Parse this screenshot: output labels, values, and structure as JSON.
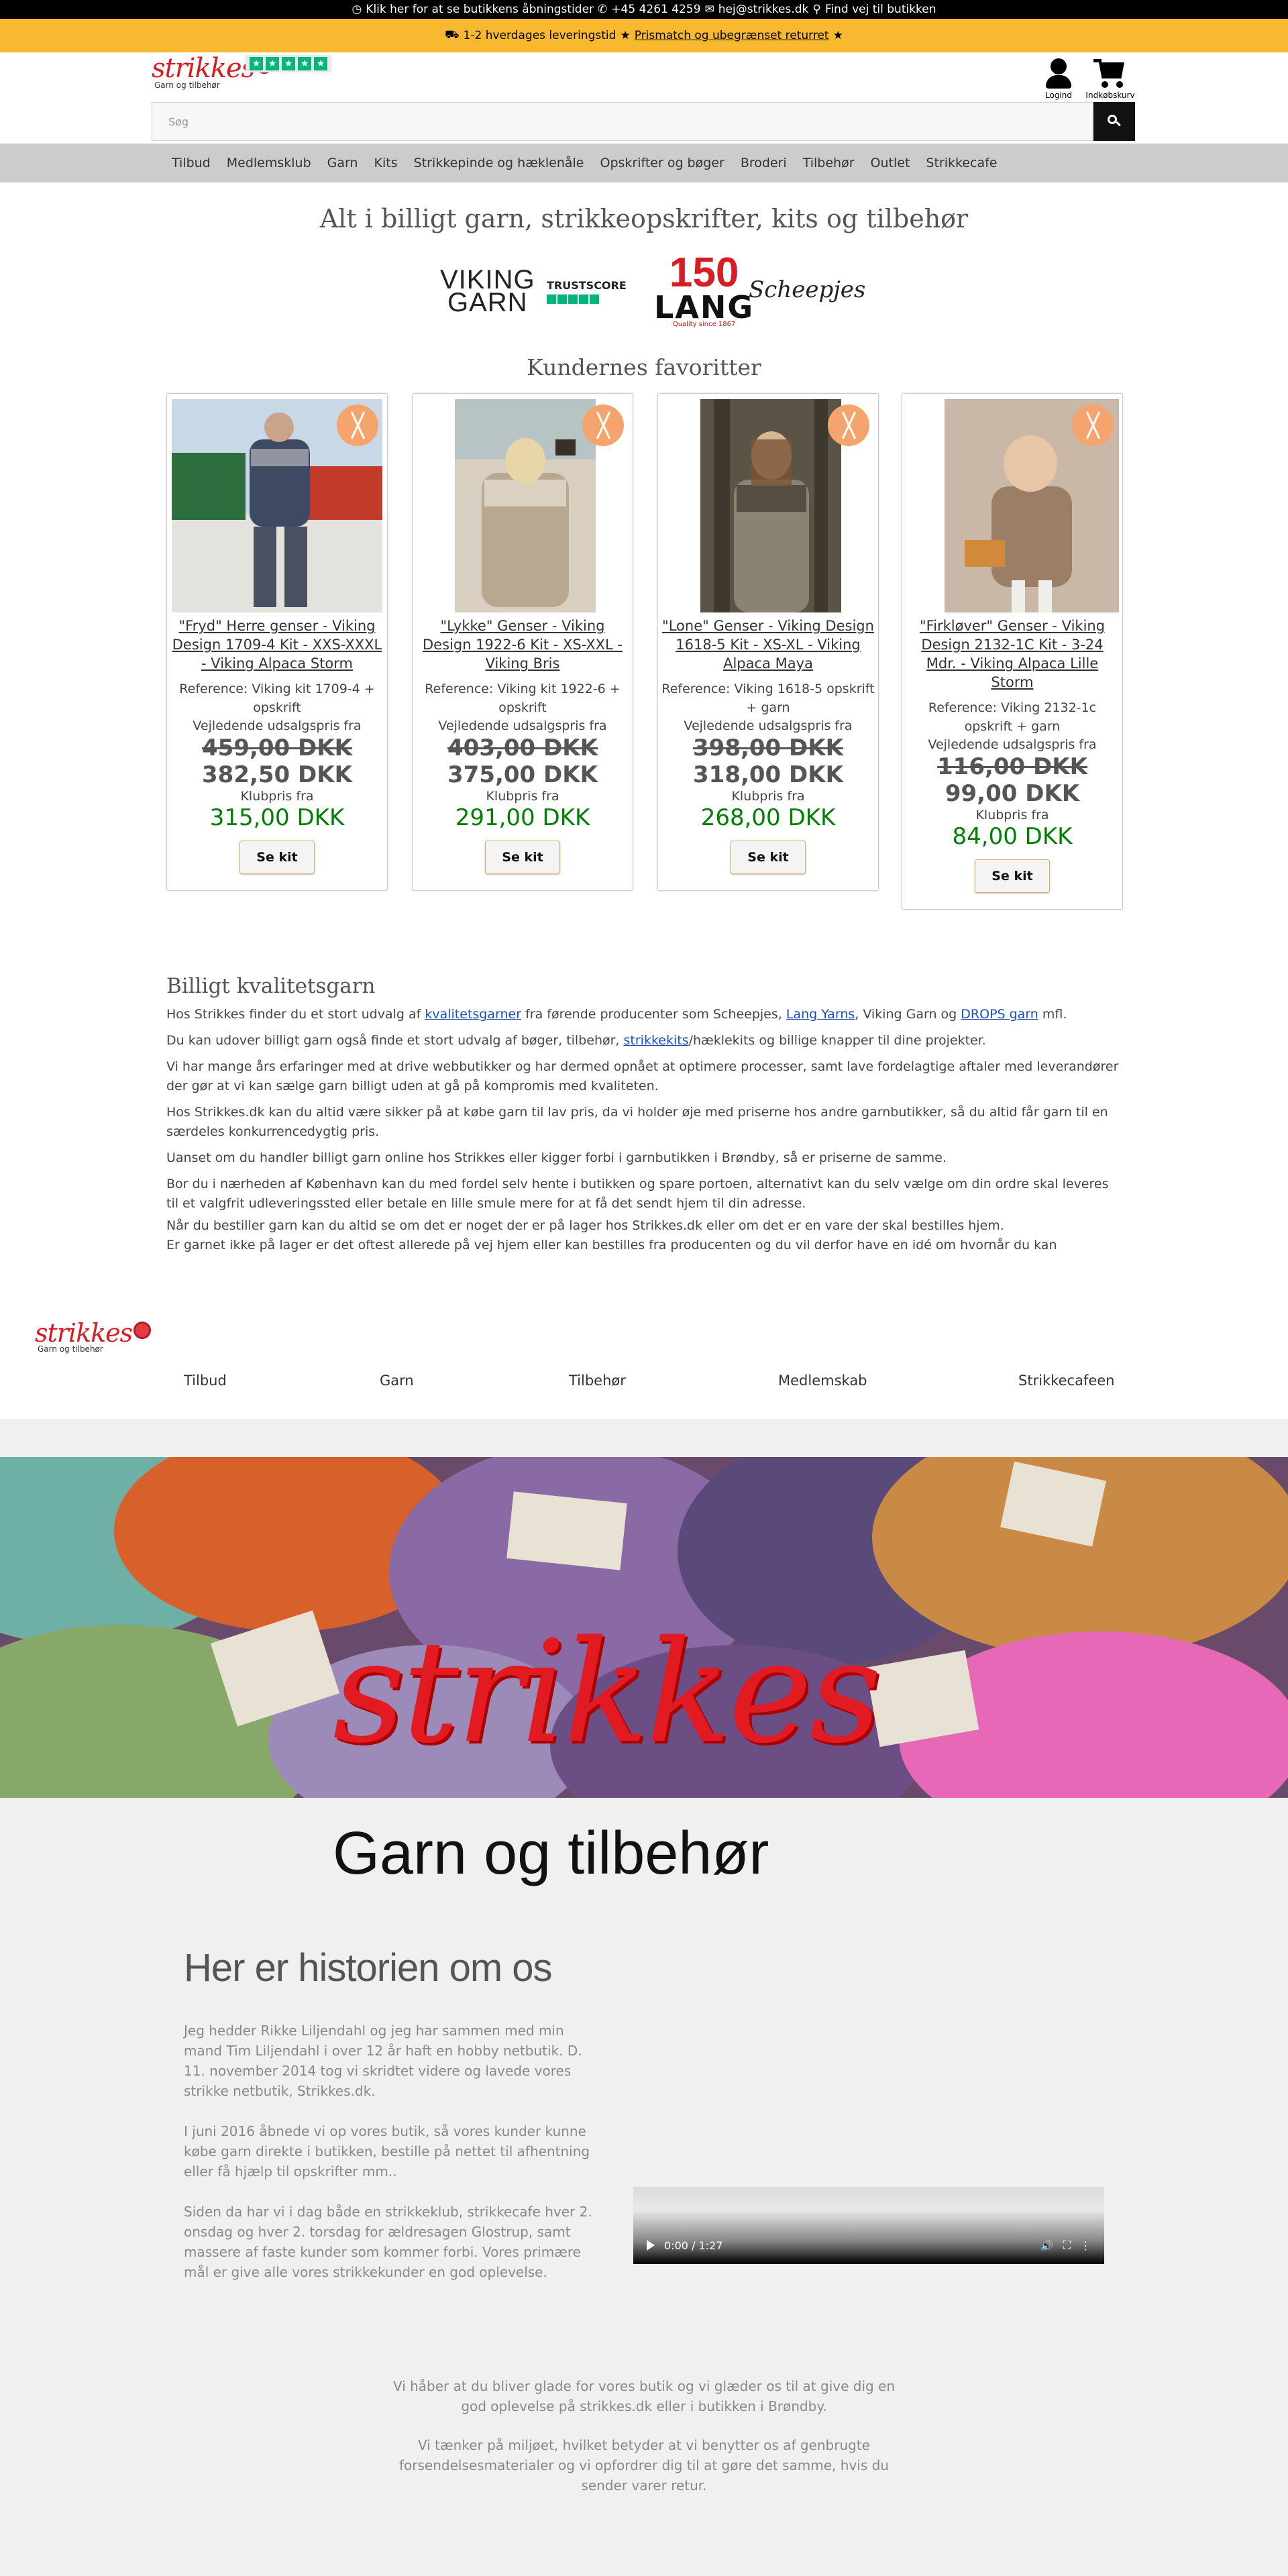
{
  "topbar": {
    "hours_icon": "clock-icon",
    "hours": "Klik her for at se butikkens åbningstider",
    "phone": "+45 4261 4259",
    "email": "hej@strikkes.dk",
    "find": "Find vej til butikken"
  },
  "shipbar": {
    "delivery": "1-2 hverdages leveringstid",
    "pricematch": "Prismatch og ubegrænset returret"
  },
  "header": {
    "logo_word": "strikkes",
    "logo_sub": "Garn og tilbehør",
    "account_label": "Logind",
    "cart_label": "Indkøbskurv",
    "search_placeholder": "Søg"
  },
  "nav": [
    "Tilbud",
    "Medlemsklub",
    "Garn",
    "Kits",
    "Strikkepinde og hæklenåle",
    "Opskrifter og bøger",
    "Broderi",
    "Tilbehør",
    "Outlet",
    "Strikkecafe"
  ],
  "main": {
    "headline": "Alt i billigt garn, strikkeopskrifter, kits og tilbehør",
    "brands": {
      "viking1": "VIKING",
      "viking2": "GARN",
      "trust": "TRUSTSCORE",
      "lang_num": "150",
      "lang_word": "LANG",
      "lang_quality": "Quality since 1867",
      "scheepjes": "Scheepjes"
    },
    "favorites_title": "Kundernes favoritter"
  },
  "products": [
    {
      "title": "\"Fryd\" Herre genser - Viking Design 1709-4 Kit - XXS-XXXL - Viking Alpaca Storm",
      "reference": "Reference: Viking kit 1709-4 + opskrift",
      "vejl": "Vejledende udsalgspris fra",
      "old_price": "459,00 DKK",
      "price": "382,50 DKK",
      "klub_label": "Klubpris fra",
      "club_price": "315,00 DKK",
      "button": "Se kit"
    },
    {
      "title": "\"Lykke\" Genser - Viking Design 1922-6 Kit - XS-XXL - Viking Bris",
      "reference": "Reference: Viking kit 1922-6 + opskrift",
      "vejl": "Vejledende udsalgspris fra",
      "old_price": "403,00 DKK",
      "price": "375,00 DKK",
      "klub_label": "Klubpris fra",
      "club_price": "291,00 DKK",
      "button": "Se kit"
    },
    {
      "title": "\"Lone\" Genser - Viking Design 1618-5 Kit - XS-XL - Viking Alpaca Maya",
      "reference": "Reference: Viking 1618-5 opskrift + garn",
      "vejl": "Vejledende udsalgspris fra",
      "old_price": "398,00 DKK",
      "price": "318,00 DKK",
      "klub_label": "Klubpris fra",
      "club_price": "268,00 DKK",
      "button": "Se kit"
    },
    {
      "title": "\"Firkløver\" Genser - Viking Design 2132-1C Kit - 3-24 Mdr. - Viking Alpaca Lille Storm",
      "reference": "Reference: Viking 2132-1c opskrift + garn",
      "vejl": "Vejledende udsalgspris fra",
      "old_price": "116,00 DKK",
      "price": "99,00 DKK",
      "klub_label": "Klubpris fra",
      "club_price": "84,00 DKK",
      "button": "Se kit"
    }
  ],
  "quality": {
    "title": "Billigt kvalitetsgarn",
    "p1_a": "Hos Strikkes finder du et stort udvalg af ",
    "p1_link1": "kvalitetsgarner",
    "p1_b": " fra førende producenter som Scheepjes, ",
    "p1_link2": "Lang Yarns",
    "p1_c": ", Viking Garn og ",
    "p1_link3": "DROPS garn",
    "p1_d": " mfl.",
    "p2_a": "Du kan udover billigt garn også finde et stort udvalg af bøger, tilbehør, ",
    "p2_link": "strikkekits",
    "p2_b": "/hæklekits og billige knapper til dine projekter.",
    "p3": "Vi har mange års erfaringer med at drive webbutikker og har dermed opnået at optimere processer, samt lave fordelagtige aftaler med leverandører der gør at vi kan sælge garn billigt uden at gå på kompromis med kvaliteten.",
    "p4": "Hos Strikkes.dk kan du altid være sikker på at købe garn til lav pris, da vi holder øje med priserne hos andre garnbutikker, så du altid får garn til en særdeles konkurrencedygtig pris.",
    "p5": "Uanset om du handler billigt garn online hos Strikkes eller kigger forbi i garnbutikken i Brøndby, så er priserne de samme.",
    "p6": "Bor du i nærheden af København kan du med fordel selv hente i butikken og spare portoen, alternativt kan du selv vælge om din ordre skal leveres til et valgfrit udleveringssted eller betale en lille smule mere for at få det sendt hjem til din adresse.",
    "p7": "Når du bestiller garn kan du altid se om det er noget der er på lager hos Strikkes.dk eller om det er en vare der skal bestilles hjem.",
    "p8": "Er garnet ikke på lager er det oftest allerede på vej hjem eller kan bestilles fra producenten og du vil derfor have en idé om hvornår du kan"
  },
  "footer_nav": {
    "logo_word": "strikkes",
    "logo_sub": "Garn og tilbehør",
    "items": [
      "Tilbud",
      "Garn",
      "Tilbehør",
      "Medlemskab",
      "Strikkecafeen"
    ]
  },
  "hero": {
    "word": "strikkes",
    "sub": "Garn og tilbehør"
  },
  "story": {
    "title": "Her er historien om os",
    "p1": "Jeg hedder Rikke Liljendahl og jeg har sammen med min mand Tim Liljendahl i over 12 år haft en hobby netbutik. D. 11. november 2014 tog vi skridtet videre og lavede vores strikke netbutik, Strikkes.dk.",
    "p2": "I juni 2016 åbnede vi op vores butik, så vores kunder kunne købe garn direkte i butikken, bestille på nettet til afhentning eller få hjælp til opskrifter mm..",
    "p3": "Siden da har vi i dag både en strikkeklub, strikkecafe hver 2. onsdag og hver 2. torsdag for ældresagen Glostrup, samt massere af faste kunder som kommer forbi. Vores primære mål er give alle vores strikkekunder en god oplevelse.",
    "video_time": "0:00 / 1:27",
    "closing1": "Vi håber at du bliver glade for vores butik og vi glæder os til at give dig en god oplevelse på strikkes.dk eller i butikken i Brøndby.",
    "closing2": "Vi tænker på miljøet, hvilket betyder at vi benytter os af genbrugte forsendelsesmaterialer og vi opfordrer dig til at gøre det samme, hvis du sender varer retur."
  },
  "colors": {
    "accent": "#f8b830",
    "brand_red": "#d71c24",
    "club_green": "#008000",
    "nav_bg": "#cccccc"
  }
}
